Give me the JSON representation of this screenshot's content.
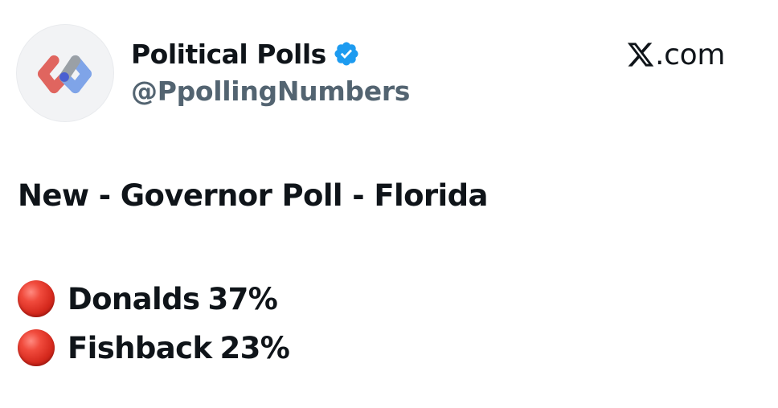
{
  "post": {
    "author": {
      "display_name": "Political Polls",
      "handle": "@PpollingNumbers",
      "verified": true,
      "avatar_icon": "network-logo-icon"
    },
    "site": {
      "icon": "x-logo-icon",
      "suffix": ".com"
    },
    "headline": "New - Governor Poll - Florida",
    "poll": [
      {
        "marker_icon": "red-circle-icon",
        "candidate": "Donalds",
        "percent": "37%"
      },
      {
        "marker_icon": "red-circle-icon",
        "candidate": "Fishback",
        "percent": "23%"
      }
    ]
  },
  "colors": {
    "text_primary": "#0f1419",
    "text_secondary": "#536471",
    "verified_blue": "#1d9bf0",
    "marker_red": "#d62a1e",
    "background": "#ffffff"
  }
}
